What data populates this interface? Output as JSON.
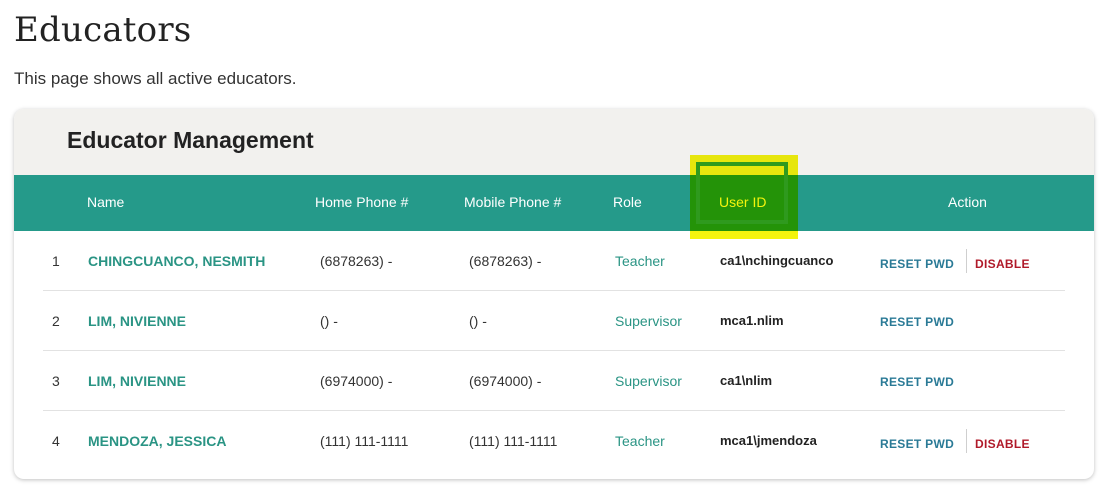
{
  "page": {
    "title": "Educators",
    "subtitle": "This page shows all active educators."
  },
  "card": {
    "title": "Educator Management"
  },
  "table": {
    "headers": {
      "name": "Name",
      "home_phone": "Home Phone #",
      "mobile_phone": "Mobile Phone #",
      "role": "Role",
      "user_id": "User ID",
      "action": "Action"
    },
    "rows": [
      {
        "num": "1",
        "name": "CHINGCUANCO, NESMITH",
        "home_phone": "(6878263) -",
        "mobile_phone": "(6878263) -",
        "role": "Teacher",
        "user_id": "ca1\\nchingcuanco",
        "reset": "RESET PWD",
        "disable": "DISABLE"
      },
      {
        "num": "2",
        "name": "LIM, NIVIENNE",
        "home_phone": "() -",
        "mobile_phone": "() -",
        "role": "Supervisor",
        "user_id": "mca1.nlim",
        "reset": "RESET PWD"
      },
      {
        "num": "3",
        "name": "LIM, NIVIENNE",
        "home_phone": "(6974000) -",
        "mobile_phone": "(6974000) -",
        "role": "Supervisor",
        "user_id": "ca1\\nlim",
        "reset": "RESET PWD"
      },
      {
        "num": "4",
        "name": "MENDOZA, JESSICA",
        "home_phone": "(111) 111-1111",
        "mobile_phone": "(111) 111-1111",
        "role": "Teacher",
        "user_id": "mca1\\jmendoza",
        "reset": "RESET PWD",
        "disable": "DISABLE"
      }
    ]
  },
  "colors": {
    "header_bg": "#259a8a",
    "link_teal": "#2a9484",
    "reset_blue": "#2a7a96",
    "disable_red": "#b01a2a",
    "highlight_yellow": "#f4f400",
    "highlight_green": "#2f9a1e"
  }
}
